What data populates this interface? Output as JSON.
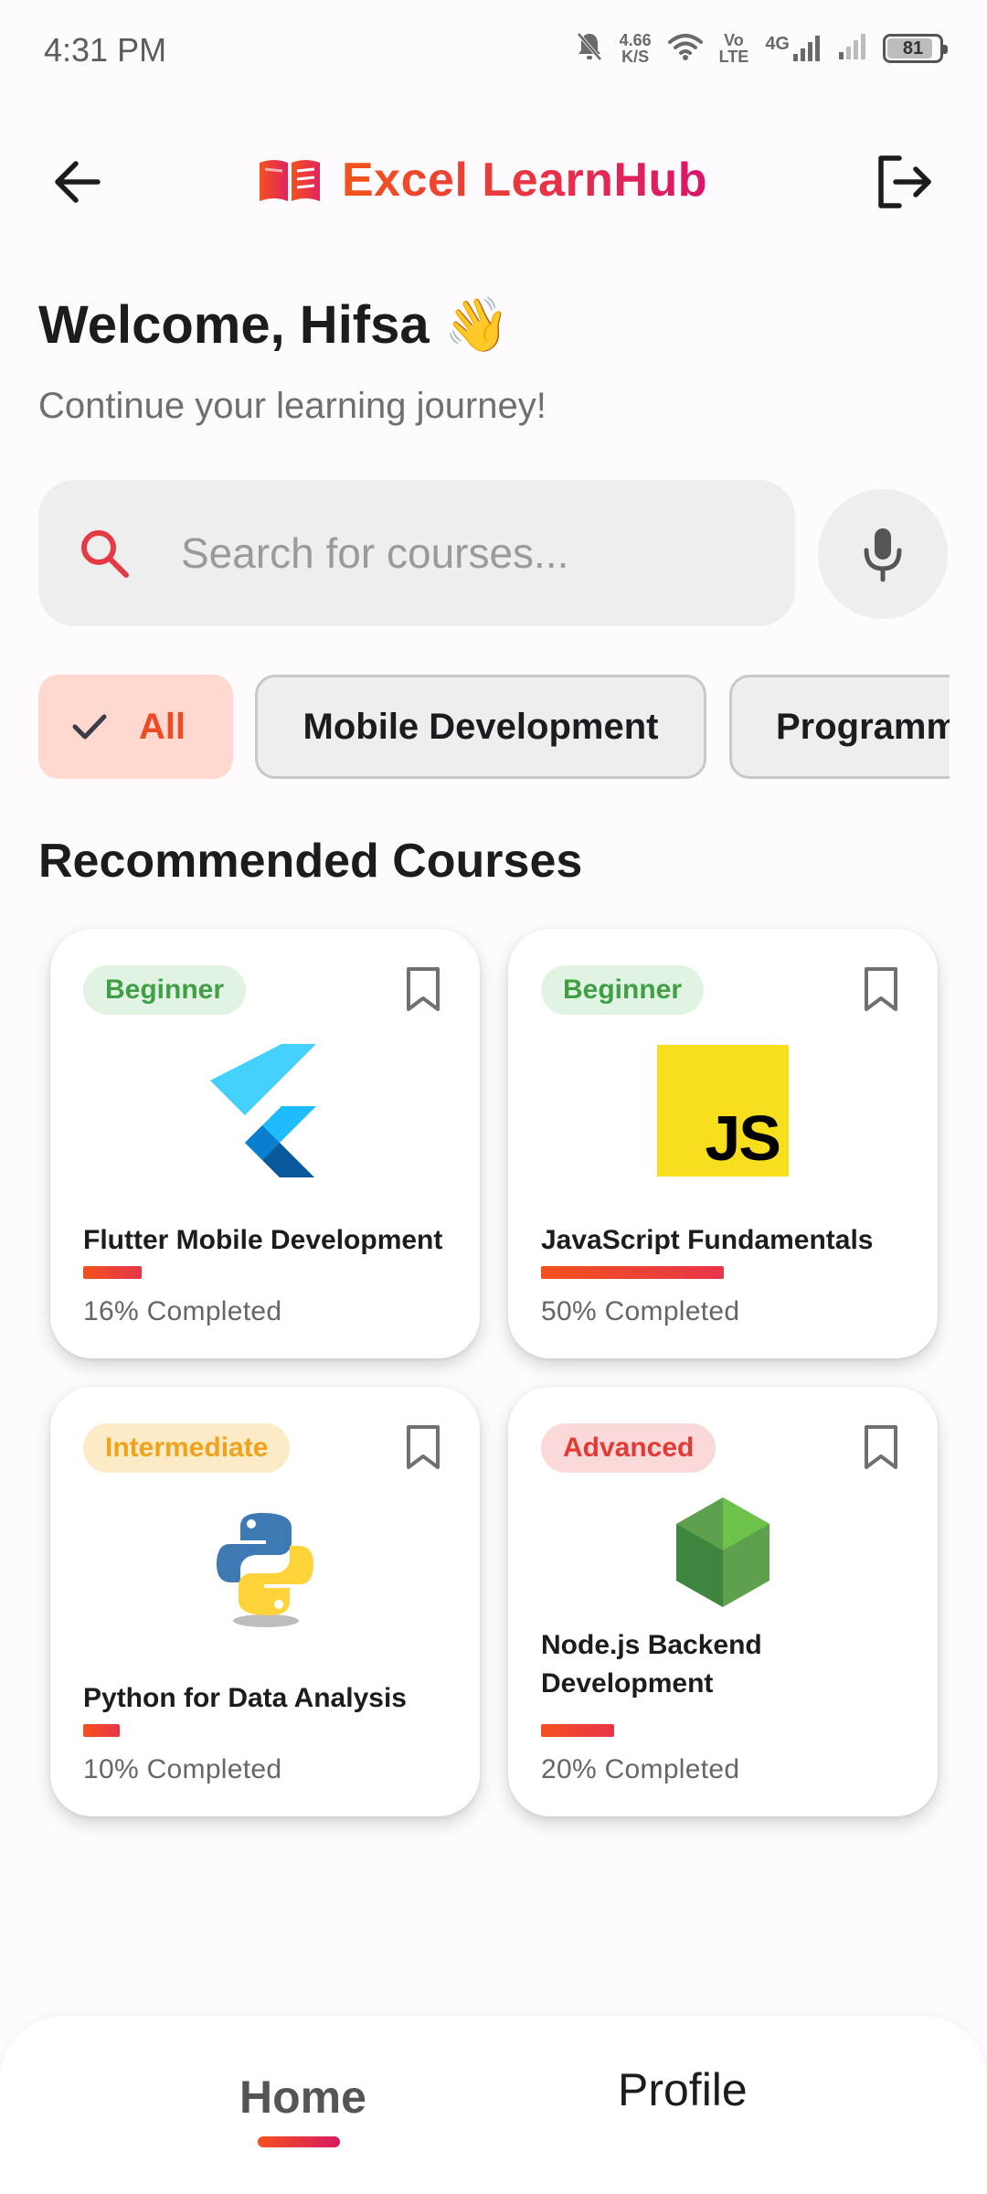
{
  "status_bar": {
    "time": "4:31 PM",
    "net_speed_value": "4.66",
    "net_speed_unit": "K/S",
    "volte_top": "Vo",
    "volte_bottom": "LTE",
    "network_type": "4G",
    "battery_level": "81"
  },
  "app_bar": {
    "title": "Excel LearnHub",
    "logo_icon": "open-book-icon",
    "back_icon": "arrow-left-icon",
    "logout_icon": "logout-icon"
  },
  "welcome": {
    "title": "Welcome, Hifsa 👋",
    "subtitle": "Continue your learning journey!"
  },
  "search": {
    "placeholder": "Search for courses...",
    "value": "",
    "icon": "search-icon",
    "voice_icon": "microphone-icon"
  },
  "filters": [
    {
      "label": "All",
      "selected": true
    },
    {
      "label": "Mobile Development",
      "selected": false
    },
    {
      "label": "Programming",
      "selected": false
    }
  ],
  "section": {
    "recommended_title": "Recommended Courses"
  },
  "courses": [
    {
      "title": "Flutter Mobile Development",
      "level": "Beginner",
      "progress": 16,
      "progress_text": "16% Completed",
      "logo": "flutter-logo"
    },
    {
      "title": "JavaScript Fundamentals",
      "level": "Beginner",
      "progress": 50,
      "progress_text": "50% Completed",
      "logo": "javascript-logo",
      "logo_text": "JS"
    },
    {
      "title": "Python for Data Analysis",
      "level": "Intermediate",
      "progress": 10,
      "progress_text": "10% Completed",
      "logo": "python-logo"
    },
    {
      "title": "Node.js Backend Development",
      "level": "Advanced",
      "progress": 20,
      "progress_text": "20% Completed",
      "logo": "nodejs-logo"
    }
  ],
  "bottom_nav": {
    "home": "Home",
    "profile": "Profile",
    "active": "Home"
  },
  "colors": {
    "accent": "#f4511e",
    "accent_pink": "#d81b60",
    "chip_selected_bg": "#ffd9cf",
    "beginner": "#3f9f45",
    "intermediate": "#f0a21a",
    "advanced": "#e53935"
  }
}
